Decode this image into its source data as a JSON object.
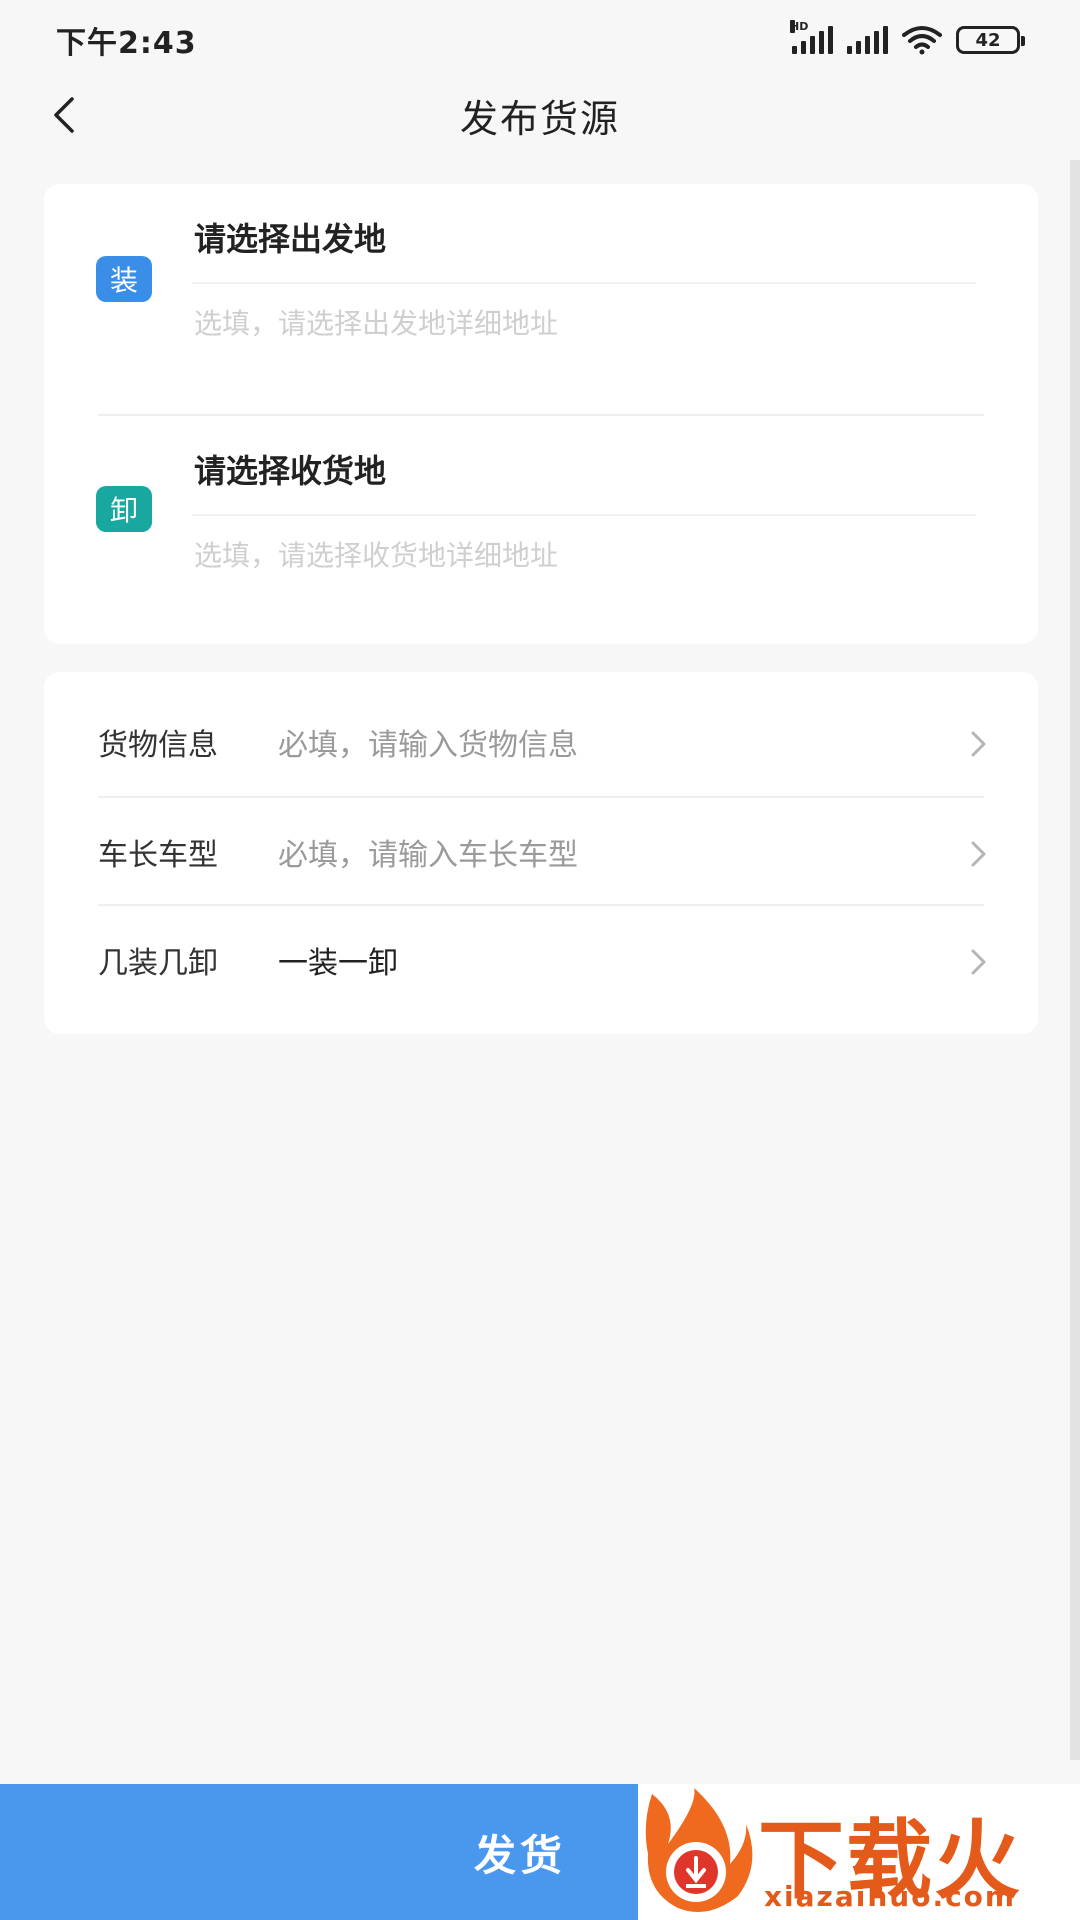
{
  "status_bar": {
    "time": "下午2:43",
    "network_label": "HD",
    "battery": "42"
  },
  "header": {
    "title": "发布货源",
    "back_icon": "chevron-left-icon"
  },
  "address": {
    "load": {
      "tag": "装",
      "tag_color": "#3a8ee8",
      "title": "请选择出发地",
      "placeholder": "选填，请选择出发地详细地址"
    },
    "unload": {
      "tag": "卸",
      "tag_color": "#19a8a0",
      "title": "请选择收货地",
      "placeholder": "选填，请选择收货地详细地址"
    }
  },
  "info_rows": [
    {
      "label": "货物信息",
      "value": "必填，请输入货物信息"
    },
    {
      "label": "车长车型",
      "value": "必填，请输入车长车型"
    },
    {
      "label": "几装几卸",
      "value": "一装一卸"
    }
  ],
  "submit": {
    "label": "发货",
    "color": "#4a98ee"
  },
  "watermark": {
    "text": "下载火",
    "url": "xiazaihuo.com"
  }
}
